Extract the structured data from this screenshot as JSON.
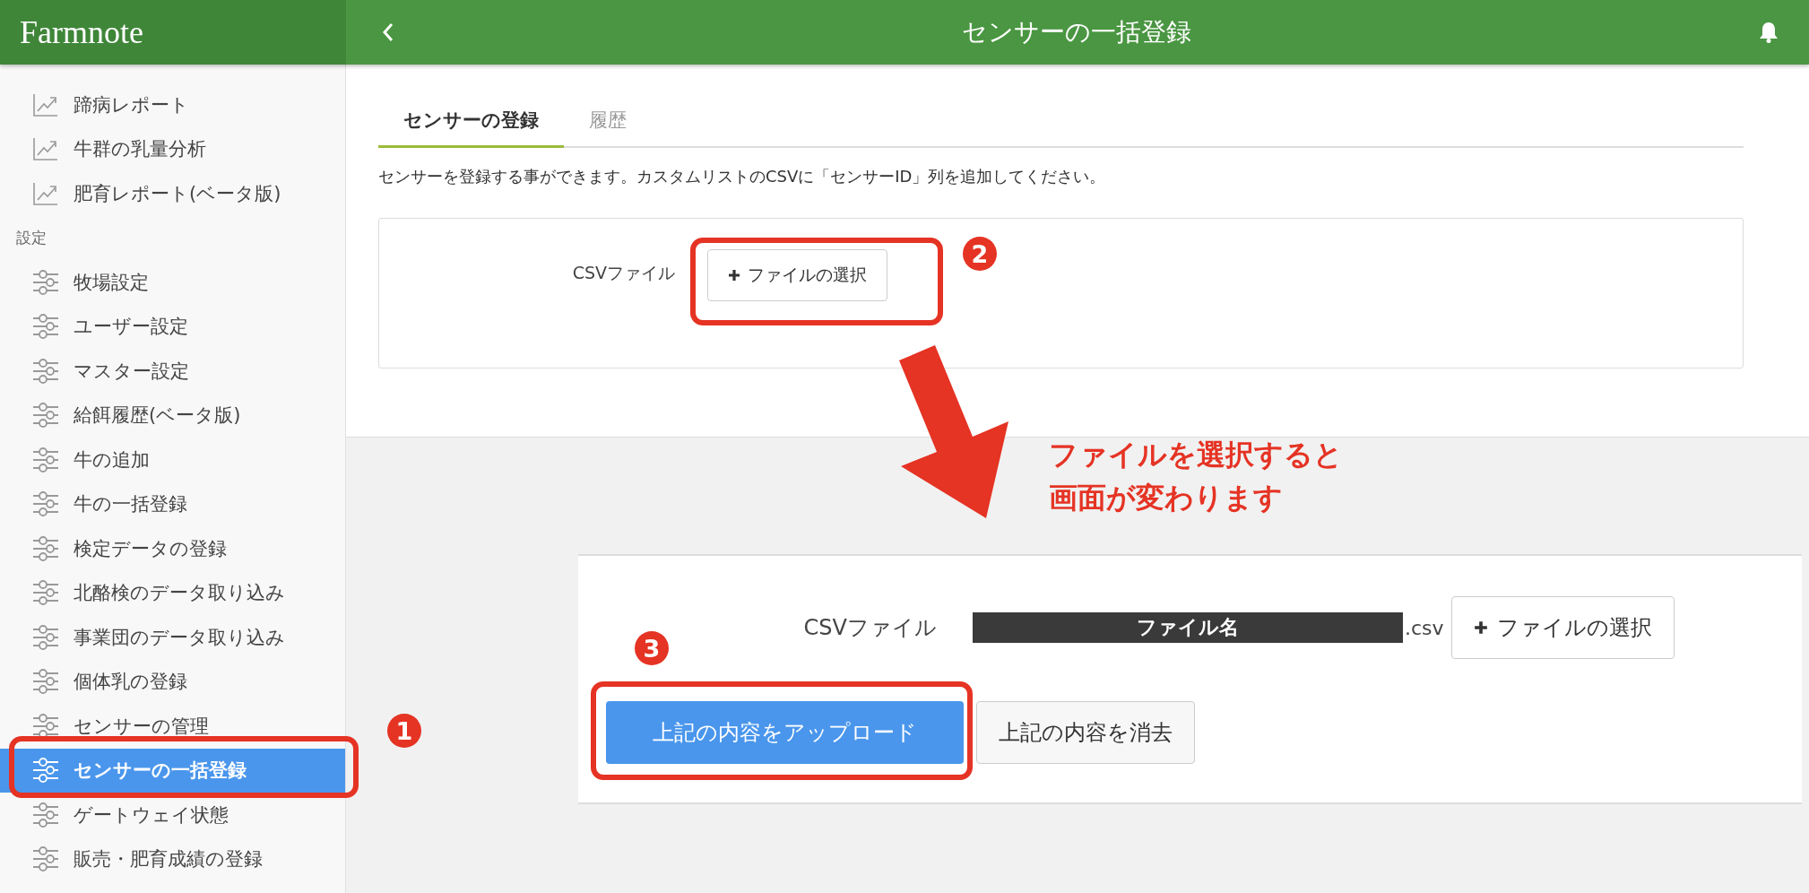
{
  "header": {
    "logo": "Farmnote",
    "title": "センサーの一括登録"
  },
  "sidebar": {
    "items": [
      {
        "kind": "report",
        "label": "蹄病レポート",
        "selected": false
      },
      {
        "kind": "report",
        "label": "牛群の乳量分析",
        "selected": false
      },
      {
        "kind": "report",
        "label": "肥育レポート(ベータ版)",
        "selected": false
      },
      {
        "kind": "heading",
        "label": "設定"
      },
      {
        "kind": "setting",
        "label": "牧場設定",
        "selected": false
      },
      {
        "kind": "setting",
        "label": "ユーザー設定",
        "selected": false
      },
      {
        "kind": "setting",
        "label": "マスター設定",
        "selected": false
      },
      {
        "kind": "setting",
        "label": "給餌履歴(ベータ版)",
        "selected": false
      },
      {
        "kind": "setting",
        "label": "牛の追加",
        "selected": false
      },
      {
        "kind": "setting",
        "label": "牛の一括登録",
        "selected": false
      },
      {
        "kind": "setting",
        "label": "検定データの登録",
        "selected": false
      },
      {
        "kind": "setting",
        "label": "北酪検のデータ取り込み",
        "selected": false
      },
      {
        "kind": "setting",
        "label": "事業団のデータ取り込み",
        "selected": false
      },
      {
        "kind": "setting",
        "label": "個体乳の登録",
        "selected": false
      },
      {
        "kind": "setting",
        "label": "センサーの管理",
        "selected": false
      },
      {
        "kind": "setting",
        "label": "センサーの一括登録",
        "selected": true
      },
      {
        "kind": "setting",
        "label": "ゲートウェイ状態",
        "selected": false
      },
      {
        "kind": "setting",
        "label": "販売・肥育成績の登録",
        "selected": false
      }
    ]
  },
  "tabs": [
    {
      "label": "センサーの登録",
      "selected": true
    },
    {
      "label": "履歴",
      "selected": false
    }
  ],
  "description": "センサーを登録する事ができます。カスタムリストのCSVに「センサーID」列を追加してください。",
  "upload_form": {
    "label": "CSVファイル",
    "button": "ファイルの選択"
  },
  "annotation": {
    "lines": [
      "ファイルを選択すると",
      "画面が変わります"
    ],
    "markers": [
      "1",
      "2",
      "3"
    ]
  },
  "after_selection": {
    "label": "CSVファイル",
    "file_name": "ファイル名",
    "extension": ".csv",
    "button": "ファイルの選択",
    "upload_button": "上記の内容をアップロード",
    "clear_button": "上記の内容を消去"
  }
}
